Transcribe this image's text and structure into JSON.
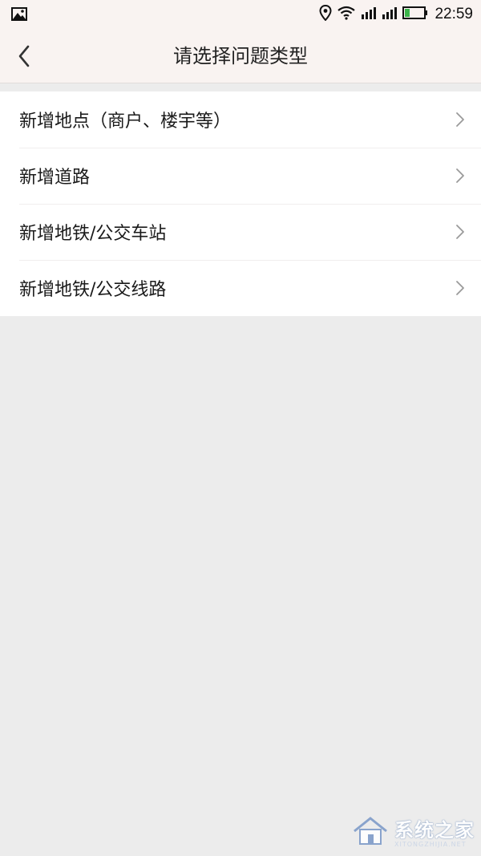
{
  "status_bar": {
    "time": "22:59",
    "icons": [
      "image-icon",
      "location-icon",
      "wifi-icon",
      "signal-icon",
      "signal-icon",
      "battery-icon"
    ]
  },
  "header": {
    "back_icon": "chevron-left-icon",
    "title": "请选择问题类型"
  },
  "list": {
    "items": [
      {
        "label": "新增地点（商户、楼宇等）",
        "icon": "chevron-right-icon"
      },
      {
        "label": "新增道路",
        "icon": "chevron-right-icon"
      },
      {
        "label": "新增地铁/公交车站",
        "icon": "chevron-right-icon"
      },
      {
        "label": "新增地铁/公交线路",
        "icon": "chevron-right-icon"
      }
    ]
  },
  "watermark": {
    "text": "系统之家",
    "subtext": "XITONGZHIJIA.NET"
  },
  "colors": {
    "header_bg": "#f9f3f1",
    "page_bg": "#ececec",
    "list_bg": "#ffffff",
    "battery_green": "#3bb54a"
  }
}
